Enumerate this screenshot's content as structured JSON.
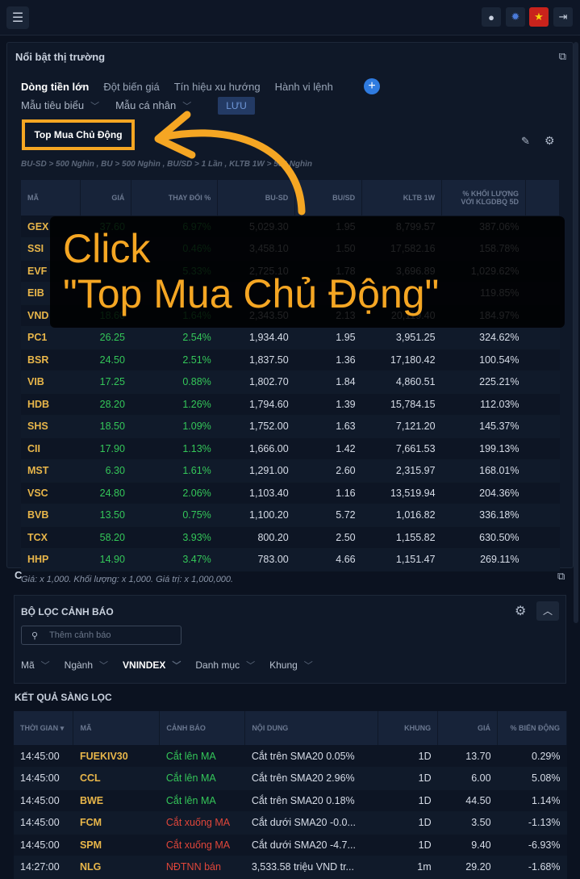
{
  "header": {
    "menu_icon": "hamburger-icon",
    "icons": [
      "user-icon",
      "theme-icon",
      "vn-flag-icon",
      "logout-icon"
    ]
  },
  "panel": {
    "title": "Nổi bật thị trường",
    "tabs": [
      "Dòng tiền lớn",
      "Đột biến giá",
      "Tín hiệu xu hướng",
      "Hành vi lệnh"
    ],
    "sub_filters": [
      "Mẫu tiêu biểu",
      "Mẫu cá nhân"
    ],
    "save_label": "LƯU",
    "selected_template": "Top Mua Chủ Động",
    "criteria": "BU-SD > 500 Nghìn , BU > 500 Nghìn , BU/SD > 1 Lần , KLTB 1W > 500 Nghìn",
    "columns": [
      "MÃ",
      "GIÁ",
      "THAY ĐỔI %",
      "BU-SD",
      "BU/SD",
      "KLTB 1W",
      "% KHỐI LƯỢNG VỚI KLGDBQ 5D"
    ],
    "rows": [
      [
        "GEX",
        "37.60",
        "6.97%",
        "5,029.30",
        "1.95",
        "8,799.57",
        "387.06%"
      ],
      [
        "SSI",
        "",
        "0.46%",
        "3,458.10",
        "1.50",
        "17,582.16",
        "158.78%"
      ],
      [
        "EVF",
        "",
        "5.33%",
        "2,725.10",
        "1.78",
        "3,696.89",
        "1,029.62%"
      ],
      [
        "EIB",
        "",
        "",
        "",
        "",
        "",
        "119.85%"
      ],
      [
        "VND",
        "18.60",
        "1.64%",
        "2,343.50",
        "2.13",
        "20,119.40",
        "184.97%"
      ],
      [
        "PC1",
        "26.25",
        "2.54%",
        "1,934.40",
        "1.95",
        "3,951.25",
        "324.62%"
      ],
      [
        "BSR",
        "24.50",
        "2.51%",
        "1,837.50",
        "1.36",
        "17,180.42",
        "100.54%"
      ],
      [
        "VIB",
        "17.25",
        "0.88%",
        "1,802.70",
        "1.84",
        "4,860.51",
        "225.21%"
      ],
      [
        "HDB",
        "28.20",
        "1.26%",
        "1,794.60",
        "1.39",
        "15,784.15",
        "112.03%"
      ],
      [
        "SHS",
        "18.50",
        "1.09%",
        "1,752.00",
        "1.63",
        "7,121.20",
        "145.37%"
      ],
      [
        "CII",
        "17.90",
        "1.13%",
        "1,666.00",
        "1.42",
        "7,661.53",
        "199.13%"
      ],
      [
        "MST",
        "6.30",
        "1.61%",
        "1,291.00",
        "2.60",
        "2,315.97",
        "168.01%"
      ],
      [
        "VSC",
        "24.80",
        "2.06%",
        "1,103.40",
        "1.16",
        "13,519.94",
        "204.36%"
      ],
      [
        "BVB",
        "13.50",
        "0.75%",
        "1,100.20",
        "5.72",
        "1,016.82",
        "336.18%"
      ],
      [
        "TCX",
        "58.20",
        "3.93%",
        "800.20",
        "2.50",
        "1,155.82",
        "630.50%"
      ],
      [
        "HHP",
        "14.90",
        "3.47%",
        "783.00",
        "4.66",
        "1,151.47",
        "269.11%"
      ]
    ],
    "note": "Giá: x 1,000. Khối lượng: x 1,000. Giá trị: x 1,000,000."
  },
  "overlay": {
    "text": "Click\n\"Top Mua Chủ Động\""
  },
  "alert_section": {
    "title_initial": "C",
    "filter_title": "BỘ LỌC CẢNH BÁO",
    "search_placeholder": "Thêm cảnh báo",
    "chips": [
      "Mã",
      "Ngành",
      "VNINDEX",
      "Danh mục",
      "Khung"
    ],
    "results_title": "KẾT QUẢ SÀNG LỌC",
    "columns": [
      "THỜI GIAN",
      "MÃ",
      "CẢNH BÁO",
      "NỘI DUNG",
      "KHUNG",
      "GIÁ",
      "% BIẾN ĐỘNG"
    ],
    "rows": [
      [
        "14:45:00",
        "FUEKIV30",
        "Cắt lên MA",
        "Cắt trên SMA20 0.05%",
        "1D",
        "13.70",
        "0.29%",
        "up"
      ],
      [
        "14:45:00",
        "CCL",
        "Cắt lên MA",
        "Cắt trên SMA20 2.96%",
        "1D",
        "6.00",
        "5.08%",
        "up"
      ],
      [
        "14:45:00",
        "BWE",
        "Cắt lên MA",
        "Cắt trên SMA20 0.18%",
        "1D",
        "44.50",
        "1.14%",
        "up"
      ],
      [
        "14:45:00",
        "FCM",
        "Cắt xuống MA",
        "Cắt dưới SMA20 -0.0...",
        "1D",
        "3.50",
        "-1.13%",
        "dn"
      ],
      [
        "14:45:00",
        "SPM",
        "Cắt xuống MA",
        "Cắt dưới SMA20 -4.7...",
        "1D",
        "9.40",
        "-6.93%",
        "dn"
      ],
      [
        "14:27:00",
        "NLG",
        "NĐTNN bán",
        "3,533.58 triệu VND tr...",
        "1m",
        "29.20",
        "-1.68%",
        "dn"
      ]
    ]
  }
}
